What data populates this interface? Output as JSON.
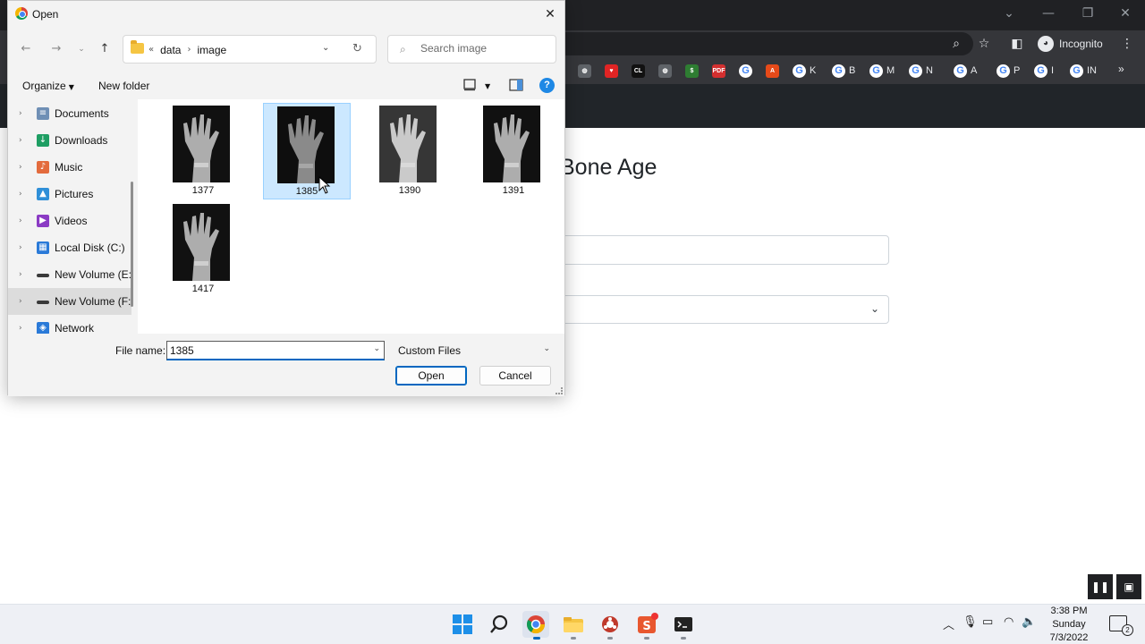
{
  "browser": {
    "profile_label": "Incognito",
    "bookmarks": [
      {
        "icon": "chrome-page-icon",
        "label": ""
      },
      {
        "icon": "heart-icon",
        "label": ""
      },
      {
        "icon": "cl-icon",
        "label": ""
      },
      {
        "icon": "globe-icon",
        "label": ""
      },
      {
        "icon": "green-site-icon",
        "label": ""
      },
      {
        "icon": "pdf-icon",
        "label": ""
      },
      {
        "icon": "google-icon",
        "label": ""
      },
      {
        "icon": "acrobat-icon",
        "label": ""
      },
      {
        "icon": "google-icon",
        "label": "K"
      },
      {
        "icon": "google-icon",
        "label": "B"
      },
      {
        "icon": "google-icon",
        "label": "M"
      },
      {
        "icon": "google-icon",
        "label": "N"
      },
      {
        "icon": "google-icon",
        "label": "A"
      },
      {
        "icon": "google-icon",
        "label": "P"
      },
      {
        "icon": "google-icon",
        "label": "I"
      },
      {
        "icon": "google-icon",
        "label": "IN"
      }
    ],
    "page_heading": "Bone Age"
  },
  "dialog": {
    "title": "Open",
    "breadcrumb": {
      "overflow": "«",
      "items": [
        "data",
        "image"
      ]
    },
    "search_placeholder": "Search image",
    "commands": {
      "organize": "Organize",
      "new_folder": "New folder"
    },
    "sidebar": [
      {
        "label": "Documents",
        "icon": "documents-icon",
        "color": "#6f8fb5"
      },
      {
        "label": "Downloads",
        "icon": "download-icon",
        "color": "#1e9e63"
      },
      {
        "label": "Music",
        "icon": "music-icon",
        "color": "#e36b3d"
      },
      {
        "label": "Pictures",
        "icon": "pictures-icon",
        "color": "#2f8fd8"
      },
      {
        "label": "Videos",
        "icon": "videos-icon",
        "color": "#8b3bc4"
      },
      {
        "label": "Local Disk (C:)",
        "icon": "windows-drive-icon",
        "color": "#2a7ad8"
      },
      {
        "label": "New Volume (E:",
        "icon": "drive-icon",
        "color": "#3a3a3a"
      },
      {
        "label": "New Volume (F:",
        "icon": "drive-icon",
        "color": "#3a3a3a",
        "selected": true
      },
      {
        "label": "Network",
        "icon": "network-icon",
        "color": "#2a7ad8"
      }
    ],
    "files": [
      {
        "name": "1377",
        "selected": false
      },
      {
        "name": "1385",
        "selected": true
      },
      {
        "name": "1390",
        "selected": false
      },
      {
        "name": "1391",
        "selected": false
      },
      {
        "name": "1417",
        "selected": false
      }
    ],
    "file_name_label": "File name:",
    "file_name_value": "1385",
    "file_type": "Custom Files",
    "open_label": "Open",
    "cancel_label": "Cancel"
  },
  "taskbar": {
    "apps": [
      "start-icon",
      "search-icon",
      "chrome-icon",
      "file-explorer-icon",
      "app-icon",
      "sublime-icon",
      "terminal-icon"
    ],
    "clock": {
      "time": "3:38 PM",
      "day": "Sunday",
      "date": "7/3/2022"
    },
    "notification_count": "2"
  },
  "colors": {
    "accent": "#0067c0",
    "selection": "#cce8ff",
    "chrome_dark": "#35363a"
  }
}
